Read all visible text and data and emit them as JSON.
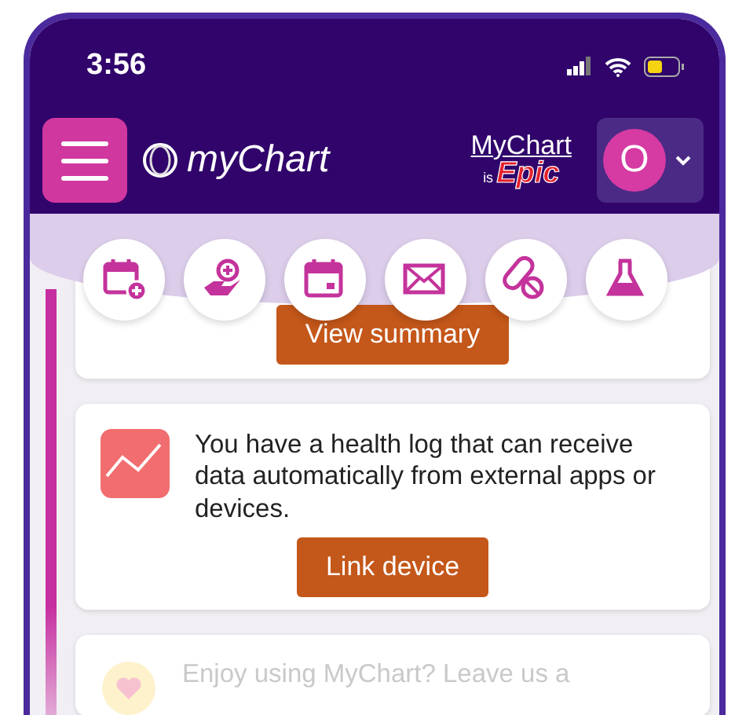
{
  "status_bar": {
    "time": "3:56"
  },
  "header": {
    "app_name": "myChart",
    "brand_top": "MyChart",
    "brand_is": "is",
    "brand_bottom": "Epic",
    "avatar_initial": "O"
  },
  "quick_actions": [
    {
      "kind": "schedule"
    },
    {
      "kind": "care"
    },
    {
      "kind": "calendar"
    },
    {
      "kind": "message"
    },
    {
      "kind": "medication"
    },
    {
      "kind": "lab"
    }
  ],
  "cards": [
    {
      "kind": "summary",
      "button": "View summary"
    },
    {
      "kind": "health_log",
      "text": "You have a health log that can receive data automatically from external apps or devices.",
      "button": "Link device"
    },
    {
      "kind": "feedback",
      "text": "Enjoy using MyChart? Leave us a"
    }
  ]
}
